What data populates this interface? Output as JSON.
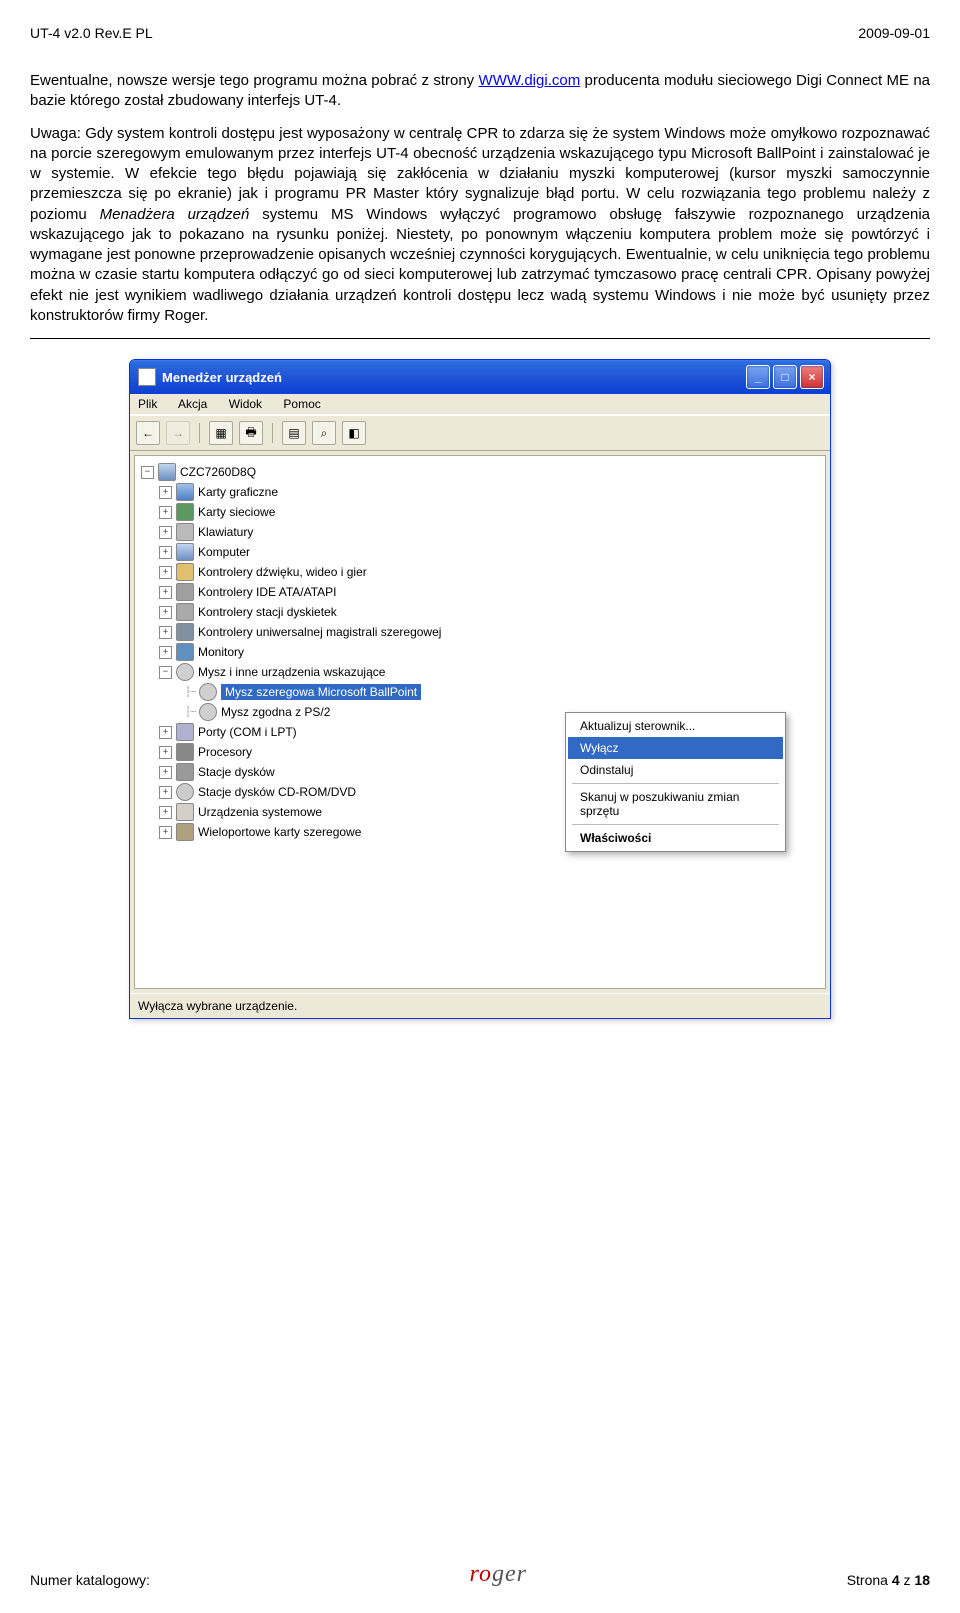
{
  "header": {
    "left": "UT-4 v2.0 Rev.E PL",
    "right": "2009-09-01"
  },
  "para1_pre": "Ewentualne, nowsze wersje tego programu można pobrać z strony ",
  "para1_link": "WWW.digi.com",
  "para1_post": " producenta modułu sieciowego Digi Connect ME na bazie którego został zbudowany interfejs UT-4.",
  "para2_pre": "Uwaga: Gdy system kontroli dostępu jest wyposażony w centralę CPR to zdarza się że system Windows może omyłkowo rozpoznawać na porcie szeregowym emulowanym przez interfejs UT-4 obecność urządzenia wskazującego typu Microsoft BallPoint i zainstalować je w systemie. W efekcie tego błędu pojawiają się zakłócenia w działaniu myszki komputerowej (kursor myszki samoczynnie przemieszcza się po ekranie) jak i programu PR Master który sygnalizuje błąd portu. W celu rozwiązania tego problemu należy z poziomu ",
  "para2_menad": "Menadżera urządzeń",
  "para2_post": " systemu MS Windows wyłączyć programowo obsługę fałszywie rozpoznanego urządzenia wskazującego jak to pokazano na rysunku poniżej. Niestety, po ponownym włączeniu komputera problem może się powtórzyć i wymagane jest ponowne przeprowadzenie opisanych wcześniej czynności korygujących. Ewentualnie, w celu uniknięcia tego problemu można w czasie startu komputera odłączyć go od sieci komputerowej lub zatrzymać tymczasowo pracę centrali CPR. Opisany powyżej efekt nie jest wynikiem wadliwego działania urządzeń kontroli dostępu lecz wadą systemu Windows i nie może być usunięty przez konstruktorów firmy Roger.",
  "devmgr": {
    "title": "Menedżer urządzeń",
    "min": "_",
    "max": "□",
    "close": "×",
    "menus": [
      "Plik",
      "Akcja",
      "Widok",
      "Pomoc"
    ],
    "tb_back": "←",
    "tb_fwd": "→",
    "root": "CZC7260D8Q",
    "items": [
      {
        "label": "Karty graficzne",
        "icon": "display"
      },
      {
        "label": "Karty sieciowe",
        "icon": "net"
      },
      {
        "label": "Klawiatury",
        "icon": "kb"
      },
      {
        "label": "Komputer",
        "icon": "computer"
      },
      {
        "label": "Kontrolery dźwięku, wideo i gier",
        "icon": "sound"
      },
      {
        "label": "Kontrolery IDE ATA/ATAPI",
        "icon": "ide"
      },
      {
        "label": "Kontrolery stacji dyskietek",
        "icon": "floppy"
      },
      {
        "label": "Kontrolery uniwersalnej magistrali szeregowej",
        "icon": "usb"
      },
      {
        "label": "Monitory",
        "icon": "monitor"
      }
    ],
    "mouse_parent": "Mysz i inne urządzenia wskazujące",
    "mouse_sel": "Mysz szeregowa Microsoft BallPoint",
    "mouse_ps2": "Mysz zgodna z PS/2",
    "items2": [
      {
        "label": "Porty (COM i LPT)",
        "icon": "port"
      },
      {
        "label": "Procesory",
        "icon": "cpu"
      },
      {
        "label": "Stacje dysków",
        "icon": "disk"
      },
      {
        "label": "Stacje dysków CD-ROM/DVD",
        "icon": "cd"
      },
      {
        "label": "Urządzenia systemowe",
        "icon": "sys"
      },
      {
        "label": "Wieloportowe karty szeregowe",
        "icon": "multi"
      }
    ],
    "ctx": {
      "update": "Aktualizuj sterownik...",
      "disable": "Wyłącz",
      "uninstall": "Odinstaluj",
      "scan": "Skanuj w poszukiwaniu zmian sprzętu",
      "props": "Właściwości"
    },
    "status": "Wyłącza wybrane urządzenie."
  },
  "footer": {
    "left": "Numer katalogowy:",
    "brand_l": "ro",
    "brand_r": "ger",
    "right_pre": "Strona ",
    "right_num": "4",
    "right_mid": " z ",
    "right_total": "18"
  }
}
